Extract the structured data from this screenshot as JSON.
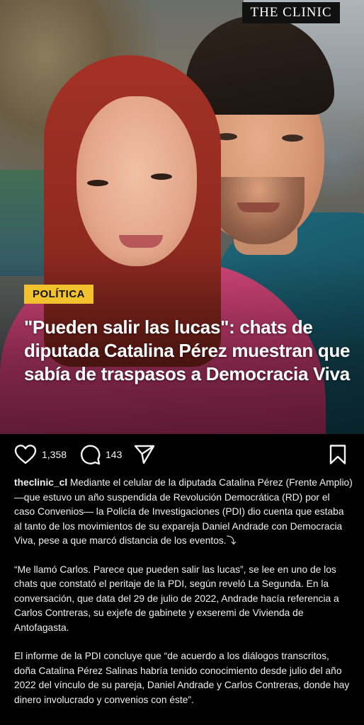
{
  "post": {
    "brand": "THE CLINIC",
    "category": "POLÍTICA",
    "headline": "\"Pueden salir las lucas\": chats de diputada Catalina Pérez muestran que sabía de traspasos a Democracia Viva"
  },
  "actions": {
    "likes": "1,358",
    "comments": "143",
    "icons": [
      "heart-icon",
      "comment-icon",
      "share-icon",
      "bookmark-icon"
    ]
  },
  "caption": {
    "username": "theclinic_cl",
    "paragraph1": " Mediante el celular de la diputada Catalina Pérez (Frente Amplio) —que estuvo un año suspendida de Revolución Democrática (RD) por el caso Convenios— la Policía de Investigaciones (PDI) dio cuenta que estaba al tanto de los movimientos de su expareja Daniel Andrade con Democracia Viva, pese a que marcó distancia de los eventos.",
    "paragraph1_emoji": "⤵",
    "paragraph2": "“Me llamó Carlos. Parece que pueden salir las lucas”, se lee en uno de los chats que constató el peritaje de la PDI, según reveló La Segunda. En la conversación, que data del 29 de julio de 2022, Andrade hacía referencia a Carlos Contreras, su exjefe de gabinete y exseremi de Vivienda de Antofagasta.",
    "paragraph3": "El informe de la PDI concluye que “de acuerdo a los diálogos transcritos, doña Catalina Pérez Salinas habría tenido conocimiento desde julio del año 2022 del vínculo de su pareja, Daniel Andrade y Carlos Contreras, donde hay dinero involucrado y convenios con éste”."
  },
  "colors": {
    "background": "#000000",
    "badge": "#f2c12e",
    "text": "#f2f2f2"
  }
}
